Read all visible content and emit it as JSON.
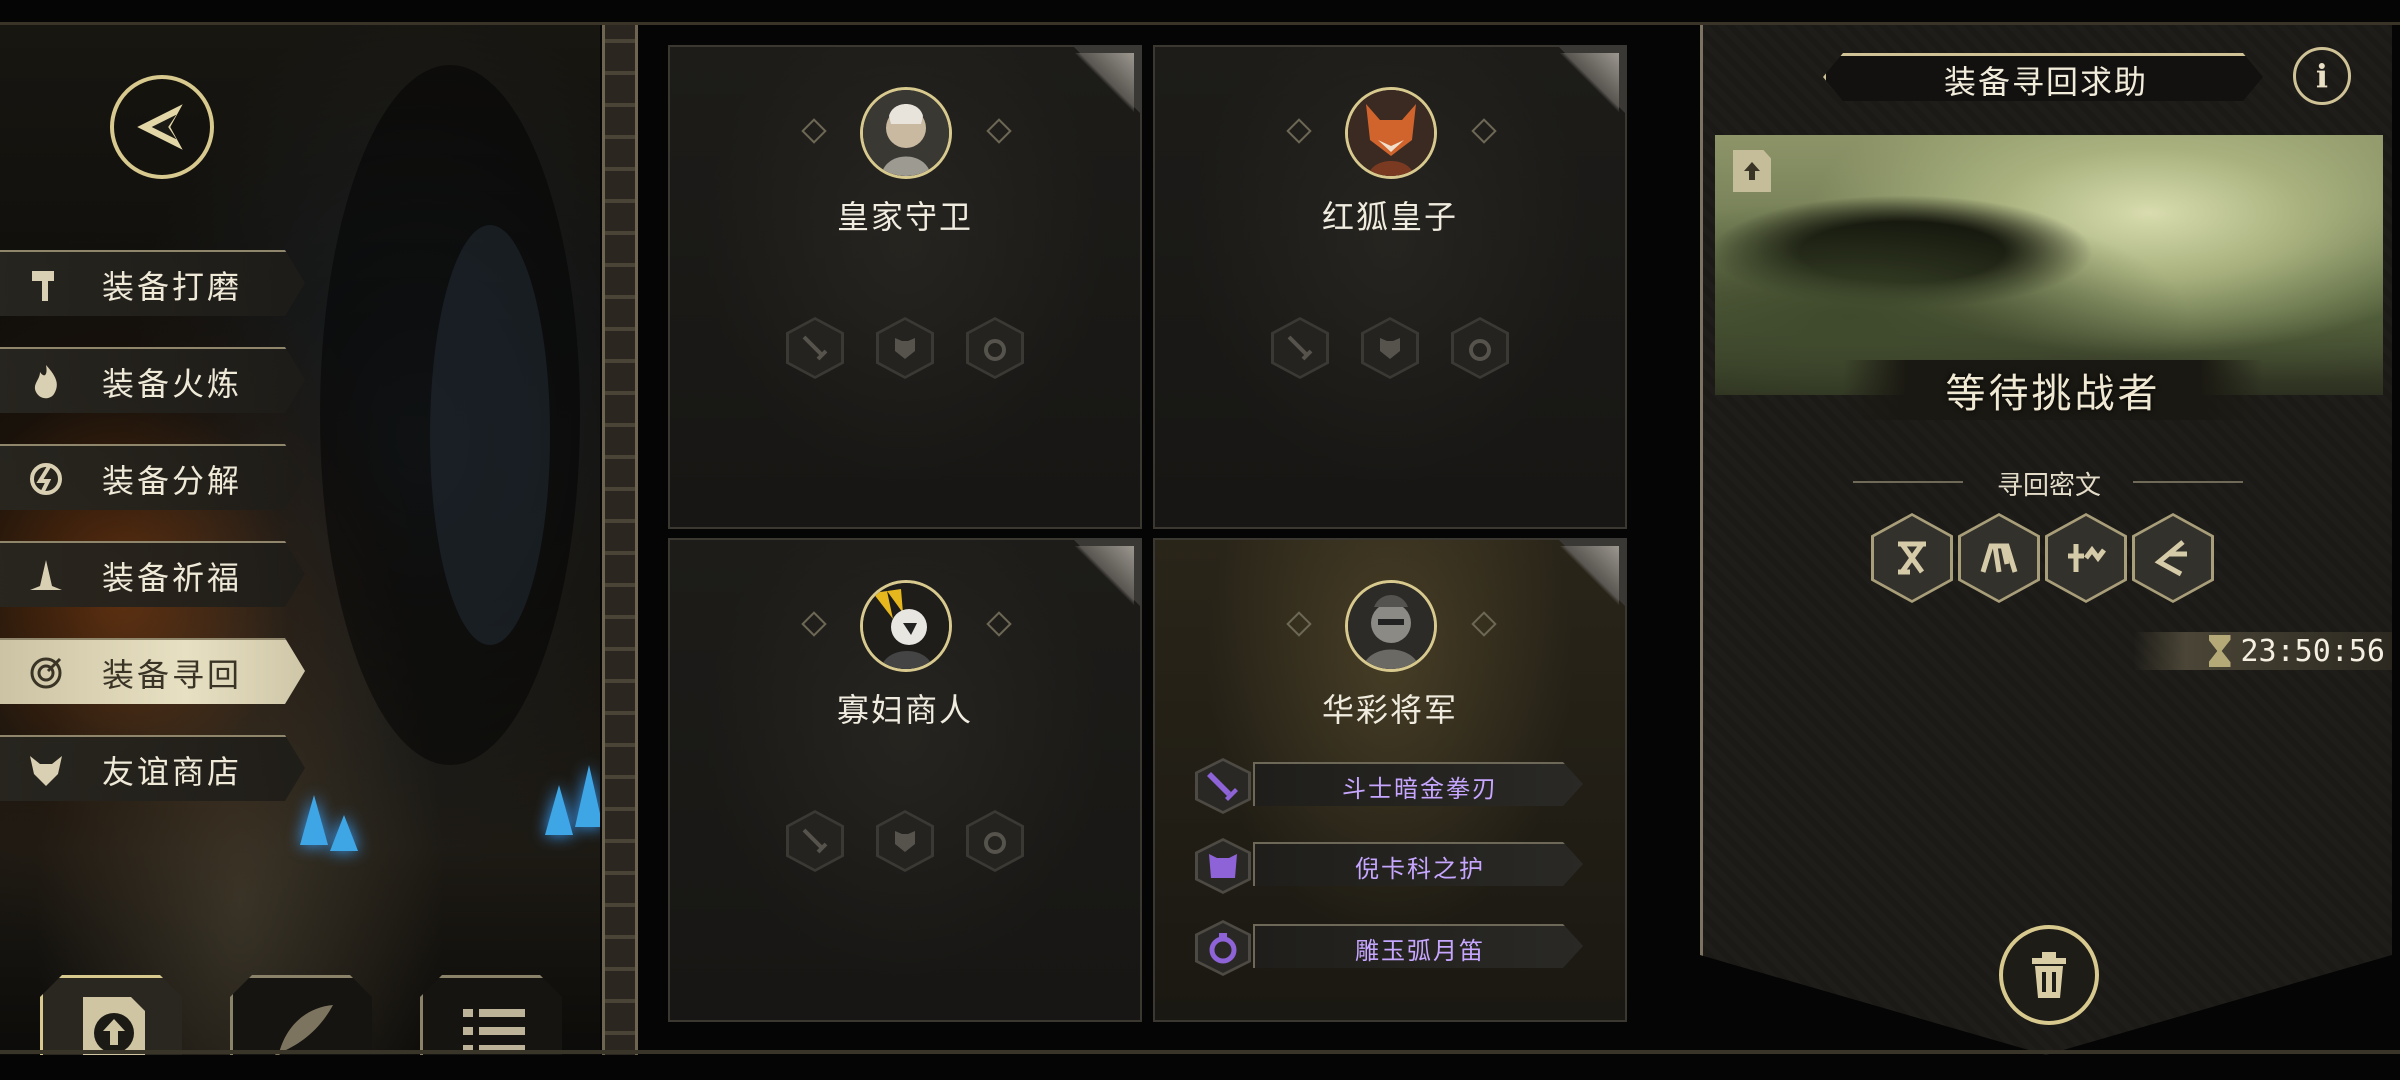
{
  "sidebar": {
    "items": [
      {
        "label": "装备打磨",
        "icon": "hammer-icon",
        "active": false
      },
      {
        "label": "装备火炼",
        "icon": "flame-icon",
        "active": false
      },
      {
        "label": "装备分解",
        "icon": "shatter-icon",
        "active": false
      },
      {
        "label": "装备祈福",
        "icon": "pray-icon",
        "active": false
      },
      {
        "label": "装备寻回",
        "icon": "target-icon",
        "active": true
      },
      {
        "label": "友谊商店",
        "icon": "fox-icon",
        "active": false
      }
    ],
    "bottom_tabs": [
      {
        "icon": "upload-icon",
        "active": true
      },
      {
        "icon": "feather-icon",
        "active": false
      },
      {
        "icon": "list-icon",
        "active": false
      }
    ]
  },
  "cards": [
    {
      "name": "皇家守卫",
      "highlight": false,
      "equipment": []
    },
    {
      "name": "红狐皇子",
      "highlight": false,
      "equipment": []
    },
    {
      "name": "寡妇商人",
      "highlight": false,
      "equipment": []
    },
    {
      "name": "华彩将军",
      "highlight": true,
      "equipment": [
        {
          "label": "斗士暗金拳刃",
          "icon": "sword-icon"
        },
        {
          "label": "倪卡科之护",
          "icon": "armor-icon"
        },
        {
          "label": "雕玉弧月笛",
          "icon": "ring-icon"
        }
      ]
    }
  ],
  "right_panel": {
    "title": "装备寻回求助",
    "info_label": "i",
    "status": "等待挑战者",
    "secret_title": "寻回密文",
    "timer": "23:50:56"
  },
  "colors": {
    "gold": "#d8c98e",
    "equipment_text": "#c6a6ff",
    "menu_active": "#e8e0c2"
  }
}
